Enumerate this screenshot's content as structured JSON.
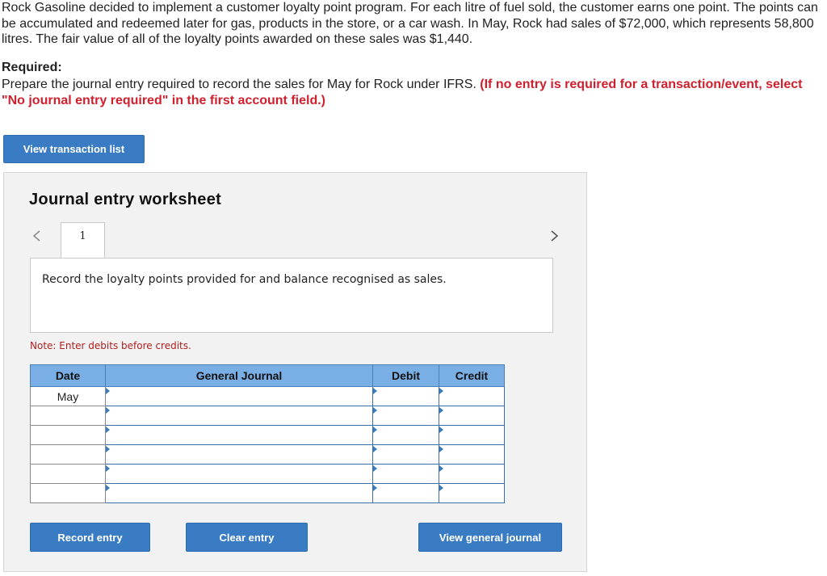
{
  "problem": {
    "text": "Rock Gasoline decided to implement a customer loyalty point program. For each litre of fuel sold, the customer earns one point. The points can be accumulated and redeemed later for gas, products in the store, or a car wash. In May, Rock had sales of $72,000, which represents 58,800 litres. The fair value of all of the loyalty points awarded on these sales was $1,440."
  },
  "required": {
    "label": "Required:",
    "text": "Prepare the journal entry required to record the sales for May for Rock under IFRS. ",
    "red_text": "(If no entry is required for a transaction/event, select \"No journal entry required\" in the first account field.)"
  },
  "buttons": {
    "view_transaction_list": "View transaction list",
    "record_entry": "Record entry",
    "clear_entry": "Clear entry",
    "view_general_journal": "View general journal"
  },
  "worksheet": {
    "title": "Journal entry worksheet",
    "prev_icon": "‹",
    "next_icon": "›",
    "tab_number": "1",
    "instruction": "Record the loyalty points provided for and balance recognised as sales.",
    "note": "Note: Enter debits before credits.",
    "table": {
      "headers": {
        "date": "Date",
        "general_journal": "General Journal",
        "debit": "Debit",
        "credit": "Credit"
      },
      "rows": [
        {
          "date": "May"
        },
        {
          "date": ""
        },
        {
          "date": ""
        },
        {
          "date": ""
        },
        {
          "date": ""
        },
        {
          "date": ""
        }
      ]
    }
  },
  "colors": {
    "button_blue": "#3a7cc4",
    "header_blue": "#7aafe6",
    "required_red": "#d0202e",
    "note_red": "#b02020",
    "worksheet_bg": "#f2f2f2"
  }
}
